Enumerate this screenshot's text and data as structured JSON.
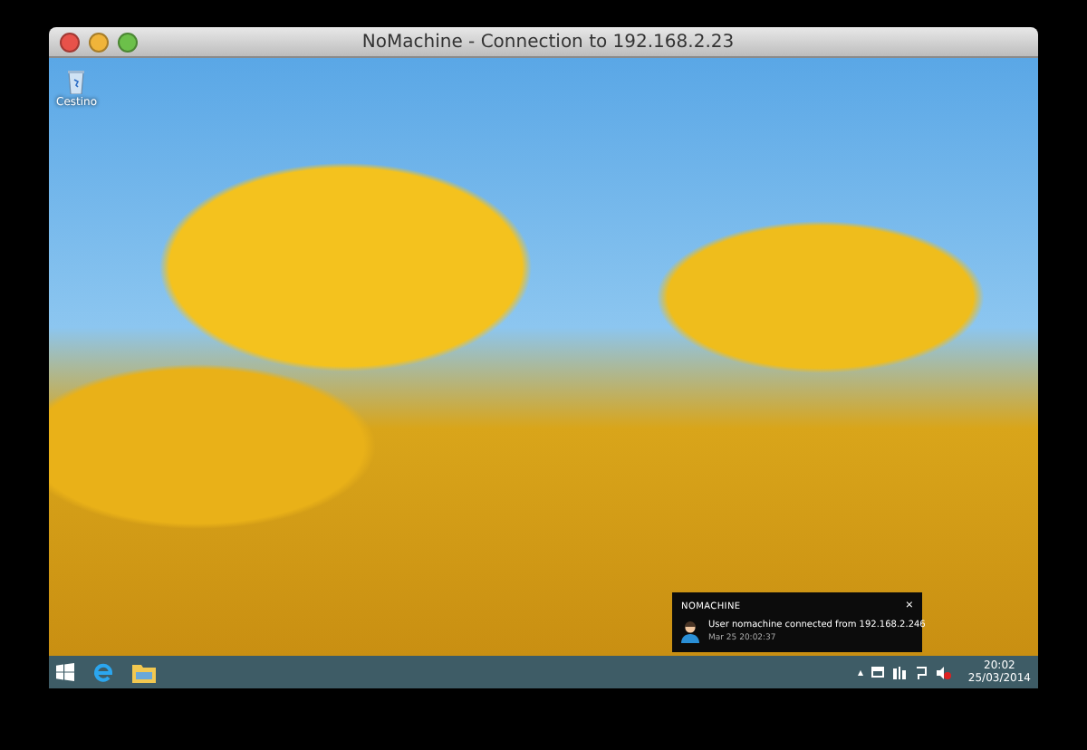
{
  "window": {
    "title": "NoMachine - Connection to 192.168.2.23"
  },
  "desktop": {
    "icons": [
      {
        "label": "Cestino"
      }
    ]
  },
  "notification": {
    "app": "NOMACHINE",
    "close": "×",
    "message": "User nomachine connected from 192.168.2.246",
    "time": "Mar 25 20:02:37"
  },
  "taskbar": {
    "tray_arrow": "▴",
    "clock": {
      "time": "20:02",
      "date": "25/03/2014"
    }
  }
}
